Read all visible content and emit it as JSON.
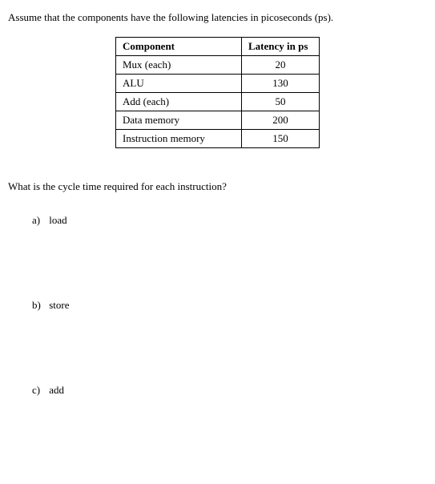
{
  "intro": "Assume that the components have the following latencies in picoseconds (ps).",
  "table": {
    "headers": {
      "component": "Component",
      "latency": "Latency in ps"
    },
    "rows": [
      {
        "component": "Mux (each)",
        "latency": "20"
      },
      {
        "component": "ALU",
        "latency": "130"
      },
      {
        "component": "Add (each)",
        "latency": "50"
      },
      {
        "component": "Data memory",
        "latency": "200"
      },
      {
        "component": "Instruction memory",
        "latency": "150"
      }
    ]
  },
  "question": "What is the cycle time required for each instruction?",
  "subs": [
    {
      "label": "a)",
      "text": "load"
    },
    {
      "label": "b)",
      "text": "store"
    },
    {
      "label": "c)",
      "text": "add"
    }
  ]
}
